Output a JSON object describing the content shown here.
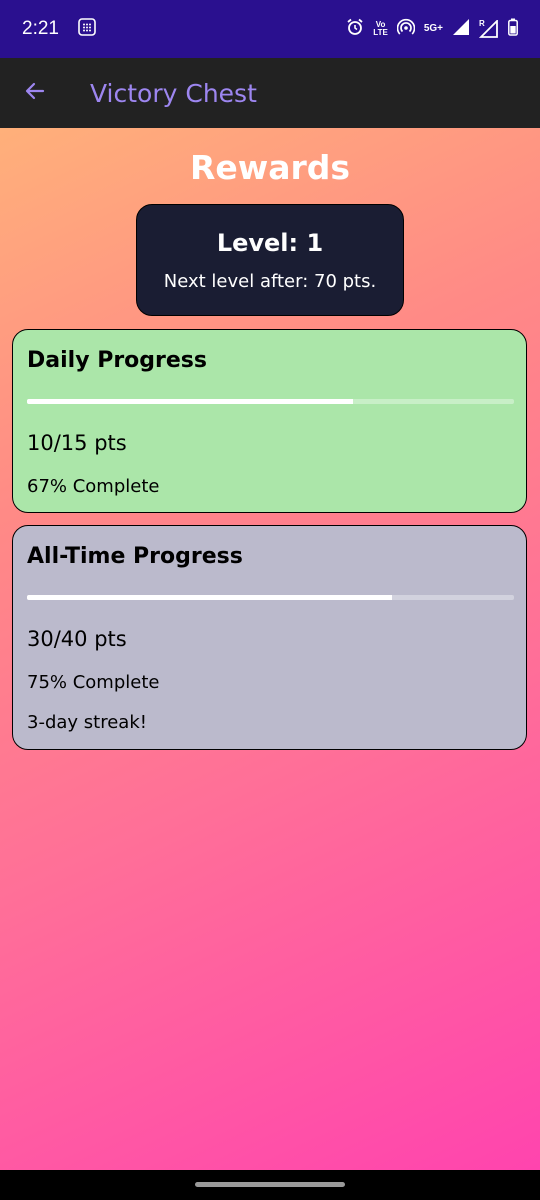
{
  "status_bar": {
    "time": "2:21",
    "volte_label_top": "Vo",
    "volte_label_bottom": "LTE",
    "network_label": "5G+",
    "roaming_label": "R"
  },
  "app_bar": {
    "title": "Victory Chest",
    "back_icon": "arrow-left-icon"
  },
  "page": {
    "title": "Rewards"
  },
  "level": {
    "label": "Level: 1",
    "next_text": "Next level after: 70 pts."
  },
  "daily": {
    "title": "Daily Progress",
    "points": "10/15 pts",
    "percent_text": "67% Complete",
    "progress": 0.67
  },
  "alltime": {
    "title": "All-Time Progress",
    "points": "30/40 pts",
    "percent_text": "75% Complete",
    "streak": "3-day streak!",
    "progress": 0.75
  },
  "colors": {
    "status_bar": "#2a108f",
    "app_bar": "#222222",
    "title_accent": "#9d86f0",
    "daily_card": "#abe6a9",
    "alltime_card": "#bbbacc",
    "level_card": "#1a1d33"
  }
}
